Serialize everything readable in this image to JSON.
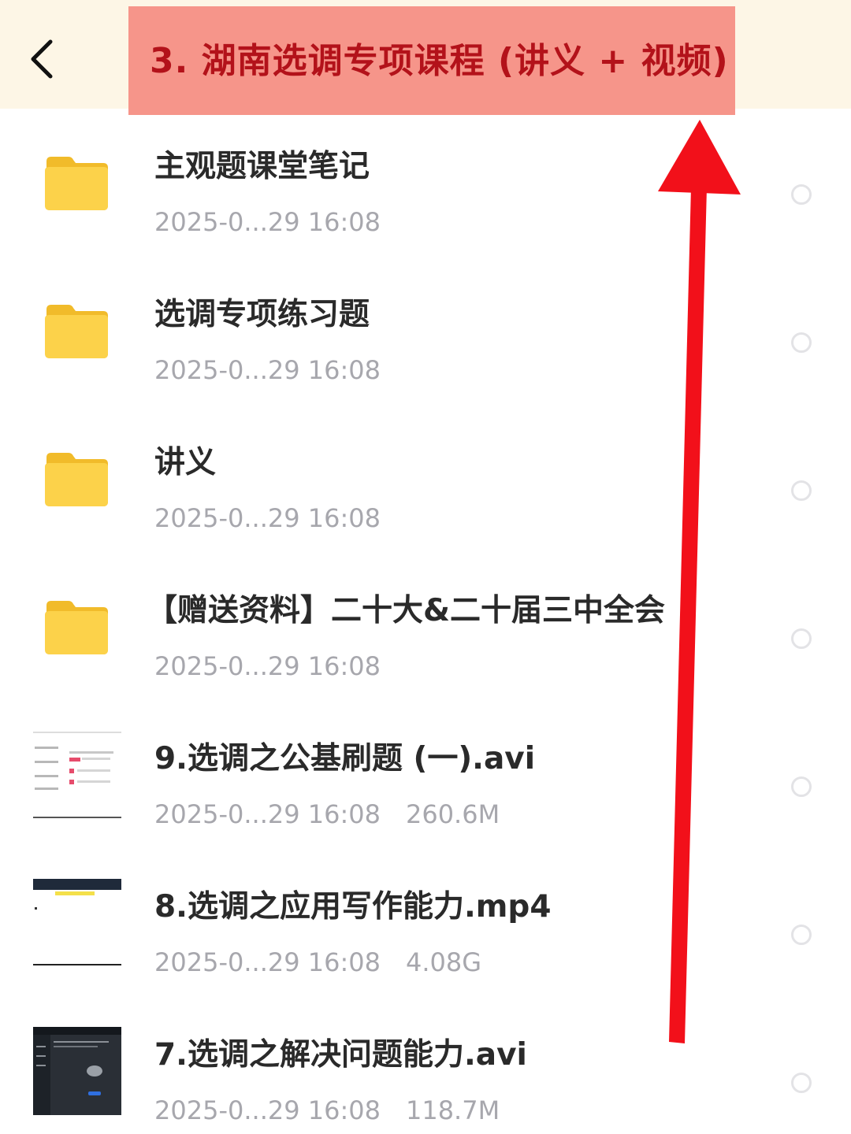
{
  "header": {
    "title": "3. 湖南选调专项课程 (讲义 + 视频)",
    "back_icon": "chevron-left-icon"
  },
  "files": [
    {
      "name": "主观题课堂笔记",
      "date": "2025-0...29 16:08",
      "size": "",
      "type": "folder",
      "icon": "folder-icon"
    },
    {
      "name": "选调专项练习题",
      "date": "2025-0...29 16:08",
      "size": "",
      "type": "folder",
      "icon": "folder-icon"
    },
    {
      "name": "讲义",
      "date": "2025-0...29 16:08",
      "size": "",
      "type": "folder",
      "icon": "folder-icon"
    },
    {
      "name": "【赠送资料】二十大&二十届三中全会",
      "date": "2025-0...29 16:08",
      "size": "",
      "type": "folder",
      "icon": "folder-icon"
    },
    {
      "name": "9.选调之公基刷题 (一).avi",
      "date": "2025-0...29 16:08",
      "size": "260.6M",
      "type": "video",
      "icon": "video-thumbnail"
    },
    {
      "name": "8.选调之应用写作能力.mp4",
      "date": "2025-0...29 16:08",
      "size": "4.08G",
      "type": "video",
      "icon": "video-thumbnail"
    },
    {
      "name": "7.选调之解决问题能力.avi",
      "date": "2025-0...29 16:08",
      "size": "118.7M",
      "type": "video",
      "icon": "video-thumbnail"
    }
  ],
  "colors": {
    "header_bg": "#fdf6e6",
    "title_highlight": "#f6958a",
    "title_text": "#b3121a",
    "folder_yellow": "#fbd346",
    "arrow_red": "#f2101a",
    "meta_gray": "#a7a7ad"
  }
}
